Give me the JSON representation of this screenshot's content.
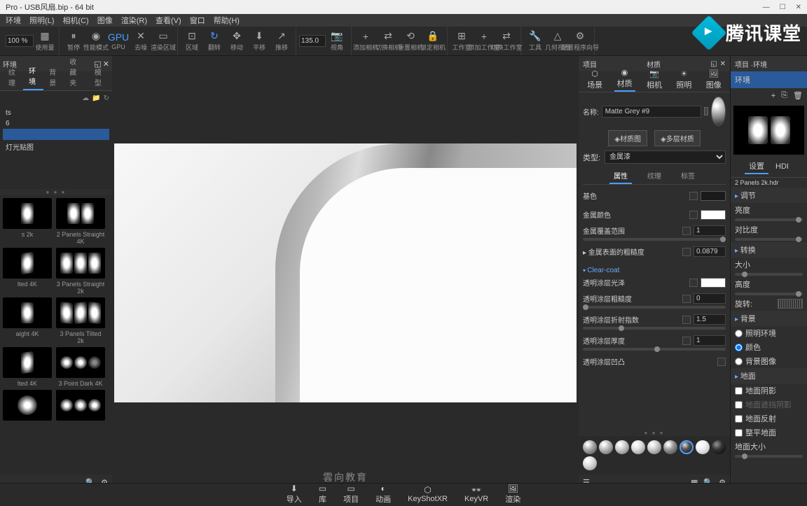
{
  "window": {
    "title": "Pro  - USB风扇.bip  - 64 bit"
  },
  "menu": {
    "items": [
      "环境",
      "照明(L)",
      "相机(C)",
      "图像",
      "渲染(R)",
      "查看(V)",
      "窗口",
      "帮助(H)"
    ]
  },
  "toolbar": {
    "zoom": "100 %",
    "fps": "135.0",
    "items": [
      {
        "icon": "▦",
        "label": "使用量"
      },
      {
        "icon": "⏸",
        "label": "暂停"
      },
      {
        "icon": "◉",
        "label": "性能模式"
      },
      {
        "icon": "GPU",
        "label": "GPU"
      },
      {
        "icon": "✕",
        "label": "去噪"
      },
      {
        "icon": "▭",
        "label": "渲染区域"
      },
      {
        "icon": "⊡",
        "label": "区域"
      },
      {
        "icon": "↻",
        "label": "翻转"
      },
      {
        "icon": "✥",
        "label": "移动"
      },
      {
        "icon": "⬇",
        "label": "平移"
      },
      {
        "icon": "↗",
        "label": "推移"
      },
      {
        "icon": "📷",
        "label": "视角"
      },
      {
        "icon": "+",
        "label": "添加相机"
      },
      {
        "icon": "⇄",
        "label": "切换相机"
      },
      {
        "icon": "⟲",
        "label": "重置相机"
      },
      {
        "icon": "🔒",
        "label": "锁定相机"
      },
      {
        "icon": "⊞",
        "label": "工作室"
      },
      {
        "icon": "+",
        "label": "添加工作室"
      },
      {
        "icon": "⇄",
        "label": "切换工作室"
      },
      {
        "icon": "🔧",
        "label": "工具"
      },
      {
        "icon": "△",
        "label": "几何视图"
      },
      {
        "icon": "⚙",
        "label": "配置程序向导"
      }
    ]
  },
  "leftPanel": {
    "title": "环境",
    "tabs": [
      "纹理",
      "环境",
      "背景",
      "收藏夹",
      "模型"
    ],
    "tree": {
      "items": [
        "ts",
        "6",
        "",
        "灯光贴图"
      ]
    },
    "thumbs": [
      {
        "label": "s 2k"
      },
      {
        "label": "2 Panels Straight 4K"
      },
      {
        "label": "lted 4K"
      },
      {
        "label": "3 Panels Straight 2k"
      },
      {
        "label": "aight 4K"
      },
      {
        "label": "3 Panels Tilted 2k"
      },
      {
        "label": "lted 4K"
      },
      {
        "label": "3 Point Dark 4K"
      },
      {
        "label": ""
      },
      {
        "label": ""
      }
    ]
  },
  "viewport": {
    "watermark": "雲向教育"
  },
  "rightPanel": {
    "tabs": {
      "left": "项目",
      "right": "材质"
    },
    "subTabs": [
      "场景",
      "材质",
      "相机",
      "照明",
      "图像"
    ],
    "nameLabel": "名称:",
    "nameValue": "Matte Grey #9",
    "matGraphBtn": "◈材质图",
    "multiLayerBtn": "◈多层材质",
    "typeLabel": "类型:",
    "typeValue": "金属漆",
    "attrTabs": [
      "属性",
      "纹理",
      "标签"
    ],
    "props": {
      "baseColor": {
        "label": "基色",
        "color": "#1a1a1a"
      },
      "metalColor": {
        "label": "金属颜色",
        "color": "#ffffff"
      },
      "metalCoverage": {
        "label": "金属覆盖范围",
        "value": "1"
      },
      "metalRoughness": {
        "label": "▸ 金属表面的粗糙度",
        "value": "0.0879"
      },
      "clearcoat": {
        "header": "Clear-coat"
      },
      "ccGloss": {
        "label": "透明涂层光泽",
        "color": "#ffffff"
      },
      "ccRoughness": {
        "label": "透明涂层粗糙度",
        "value": "0"
      },
      "ccIOR": {
        "label": "透明涂层折射指数",
        "value": "1.5"
      },
      "ccThickness": {
        "label": "透明涂层厚度",
        "value": "1"
      },
      "ccBump": {
        "label": "透明涂层凹凸"
      }
    }
  },
  "farRight": {
    "tab": "项目 ·环境",
    "envItem": "环境",
    "settingsBtn": "设置",
    "hdrName": "2 Panels 2k.hdr",
    "adjust": {
      "header": "调节",
      "brightness": "亮度",
      "contrast": "对比度"
    },
    "transform": {
      "header": "转换",
      "size": "大小",
      "height": "高度",
      "rotation": "旋转:"
    },
    "background": {
      "header": "背景",
      "lighting": "照明环境",
      "color": "颜色",
      "image": "背景图像"
    },
    "ground": {
      "header": "地面",
      "shadow": "地面阴影",
      "occlusion": "地面遮挡阴影",
      "reflect": "地面反射",
      "flatten": "整平地面",
      "size": "地面大小"
    }
  },
  "bottomBar": {
    "tabs": [
      "导入",
      "库",
      "项目",
      "动画",
      "KeyShotXR",
      "KeyVR",
      "渲染"
    ]
  },
  "logo": {
    "text": "腾讯课堂"
  }
}
